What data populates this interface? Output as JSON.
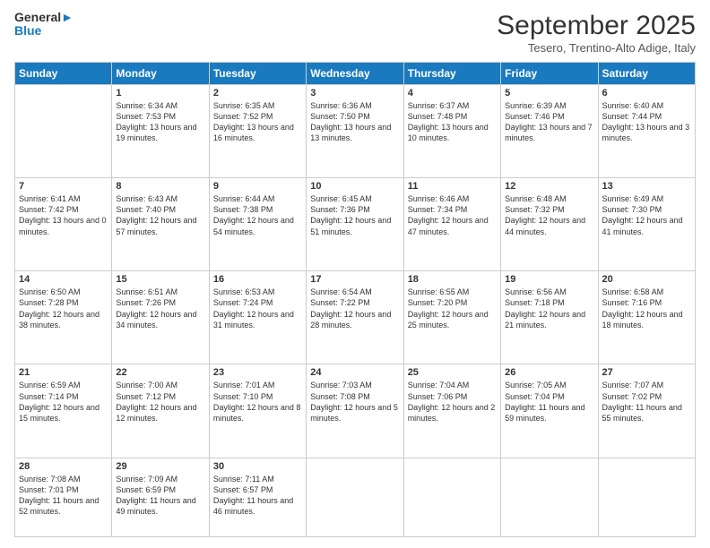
{
  "header": {
    "logo_line1": "General",
    "logo_line2": "Blue",
    "title": "September 2025",
    "location": "Tesero, Trentino-Alto Adige, Italy"
  },
  "days_of_week": [
    "Sunday",
    "Monday",
    "Tuesday",
    "Wednesday",
    "Thursday",
    "Friday",
    "Saturday"
  ],
  "weeks": [
    [
      {
        "day": "",
        "text": ""
      },
      {
        "day": "1",
        "text": "Sunrise: 6:34 AM\nSunset: 7:53 PM\nDaylight: 13 hours and 19 minutes."
      },
      {
        "day": "2",
        "text": "Sunrise: 6:35 AM\nSunset: 7:52 PM\nDaylight: 13 hours and 16 minutes."
      },
      {
        "day": "3",
        "text": "Sunrise: 6:36 AM\nSunset: 7:50 PM\nDaylight: 13 hours and 13 minutes."
      },
      {
        "day": "4",
        "text": "Sunrise: 6:37 AM\nSunset: 7:48 PM\nDaylight: 13 hours and 10 minutes."
      },
      {
        "day": "5",
        "text": "Sunrise: 6:39 AM\nSunset: 7:46 PM\nDaylight: 13 hours and 7 minutes."
      },
      {
        "day": "6",
        "text": "Sunrise: 6:40 AM\nSunset: 7:44 PM\nDaylight: 13 hours and 3 minutes."
      }
    ],
    [
      {
        "day": "7",
        "text": "Sunrise: 6:41 AM\nSunset: 7:42 PM\nDaylight: 13 hours and 0 minutes."
      },
      {
        "day": "8",
        "text": "Sunrise: 6:43 AM\nSunset: 7:40 PM\nDaylight: 12 hours and 57 minutes."
      },
      {
        "day": "9",
        "text": "Sunrise: 6:44 AM\nSunset: 7:38 PM\nDaylight: 12 hours and 54 minutes."
      },
      {
        "day": "10",
        "text": "Sunrise: 6:45 AM\nSunset: 7:36 PM\nDaylight: 12 hours and 51 minutes."
      },
      {
        "day": "11",
        "text": "Sunrise: 6:46 AM\nSunset: 7:34 PM\nDaylight: 12 hours and 47 minutes."
      },
      {
        "day": "12",
        "text": "Sunrise: 6:48 AM\nSunset: 7:32 PM\nDaylight: 12 hours and 44 minutes."
      },
      {
        "day": "13",
        "text": "Sunrise: 6:49 AM\nSunset: 7:30 PM\nDaylight: 12 hours and 41 minutes."
      }
    ],
    [
      {
        "day": "14",
        "text": "Sunrise: 6:50 AM\nSunset: 7:28 PM\nDaylight: 12 hours and 38 minutes."
      },
      {
        "day": "15",
        "text": "Sunrise: 6:51 AM\nSunset: 7:26 PM\nDaylight: 12 hours and 34 minutes."
      },
      {
        "day": "16",
        "text": "Sunrise: 6:53 AM\nSunset: 7:24 PM\nDaylight: 12 hours and 31 minutes."
      },
      {
        "day": "17",
        "text": "Sunrise: 6:54 AM\nSunset: 7:22 PM\nDaylight: 12 hours and 28 minutes."
      },
      {
        "day": "18",
        "text": "Sunrise: 6:55 AM\nSunset: 7:20 PM\nDaylight: 12 hours and 25 minutes."
      },
      {
        "day": "19",
        "text": "Sunrise: 6:56 AM\nSunset: 7:18 PM\nDaylight: 12 hours and 21 minutes."
      },
      {
        "day": "20",
        "text": "Sunrise: 6:58 AM\nSunset: 7:16 PM\nDaylight: 12 hours and 18 minutes."
      }
    ],
    [
      {
        "day": "21",
        "text": "Sunrise: 6:59 AM\nSunset: 7:14 PM\nDaylight: 12 hours and 15 minutes."
      },
      {
        "day": "22",
        "text": "Sunrise: 7:00 AM\nSunset: 7:12 PM\nDaylight: 12 hours and 12 minutes."
      },
      {
        "day": "23",
        "text": "Sunrise: 7:01 AM\nSunset: 7:10 PM\nDaylight: 12 hours and 8 minutes."
      },
      {
        "day": "24",
        "text": "Sunrise: 7:03 AM\nSunset: 7:08 PM\nDaylight: 12 hours and 5 minutes."
      },
      {
        "day": "25",
        "text": "Sunrise: 7:04 AM\nSunset: 7:06 PM\nDaylight: 12 hours and 2 minutes."
      },
      {
        "day": "26",
        "text": "Sunrise: 7:05 AM\nSunset: 7:04 PM\nDaylight: 11 hours and 59 minutes."
      },
      {
        "day": "27",
        "text": "Sunrise: 7:07 AM\nSunset: 7:02 PM\nDaylight: 11 hours and 55 minutes."
      }
    ],
    [
      {
        "day": "28",
        "text": "Sunrise: 7:08 AM\nSunset: 7:01 PM\nDaylight: 11 hours and 52 minutes."
      },
      {
        "day": "29",
        "text": "Sunrise: 7:09 AM\nSunset: 6:59 PM\nDaylight: 11 hours and 49 minutes."
      },
      {
        "day": "30",
        "text": "Sunrise: 7:11 AM\nSunset: 6:57 PM\nDaylight: 11 hours and 46 minutes."
      },
      {
        "day": "",
        "text": ""
      },
      {
        "day": "",
        "text": ""
      },
      {
        "day": "",
        "text": ""
      },
      {
        "day": "",
        "text": ""
      }
    ]
  ]
}
